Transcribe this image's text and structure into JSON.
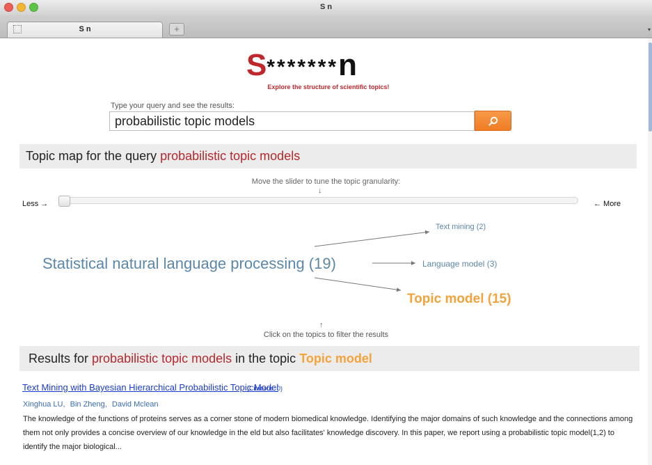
{
  "window": {
    "title": "S         n"
  },
  "tab": {
    "title": "S         n",
    "new_tab_label": "+",
    "menu_label": "▾"
  },
  "logo": {
    "s": "S",
    "middle": "*******",
    "n": "n",
    "tagline": "Explore the structure of scientific topics!"
  },
  "search": {
    "label": "Type your query and see the results:",
    "value": "probabilistic topic models",
    "button_icon": "search-icon"
  },
  "topic_map": {
    "prefix": "Topic map for the query ",
    "query": "probabilistic topic models"
  },
  "slider": {
    "hint": "Move the slider to tune the topic granularity:",
    "hint_arrow": "↓",
    "less": "Less →",
    "more": "← More",
    "level": 0
  },
  "topics": {
    "main": "Statistical natural language processing (19)",
    "text_mining": "Text mining (2)",
    "language_model": "Language model (3)",
    "topic_model": "Topic model (15)"
  },
  "filter_hint": {
    "arrow": "↑",
    "text": "Click on the topics to filter the results"
  },
  "results": {
    "prefix": "Results for ",
    "query": "probabilistic topic models",
    "middle": " in the topic ",
    "topic": "Topic model",
    "items": [
      {
        "title": "Text Mining with Bayesian Hierarchical Probabilistic Topic Model",
        "citations": "(Citations: 0)",
        "authors": [
          "Xinghua LU",
          "Bin Zheng",
          "David Mclean"
        ],
        "abstract": "The knowledge of the functions of proteins serves as a corner stone of modern biomedical knowledge. Identifying the major domains of such knowledge and the connections among them not only provides a concise overview of our knowledge in the eld but also facilitates' knowledge discovery. In this paper, we report using a probabilistic topic model(1,2) to identify the major biological..."
      }
    ]
  },
  "colors": {
    "accent_red": "#b5282d",
    "accent_orange": "#f4a33b",
    "topic_blue": "#5b87a8",
    "link_blue": "#1a3ccc"
  }
}
